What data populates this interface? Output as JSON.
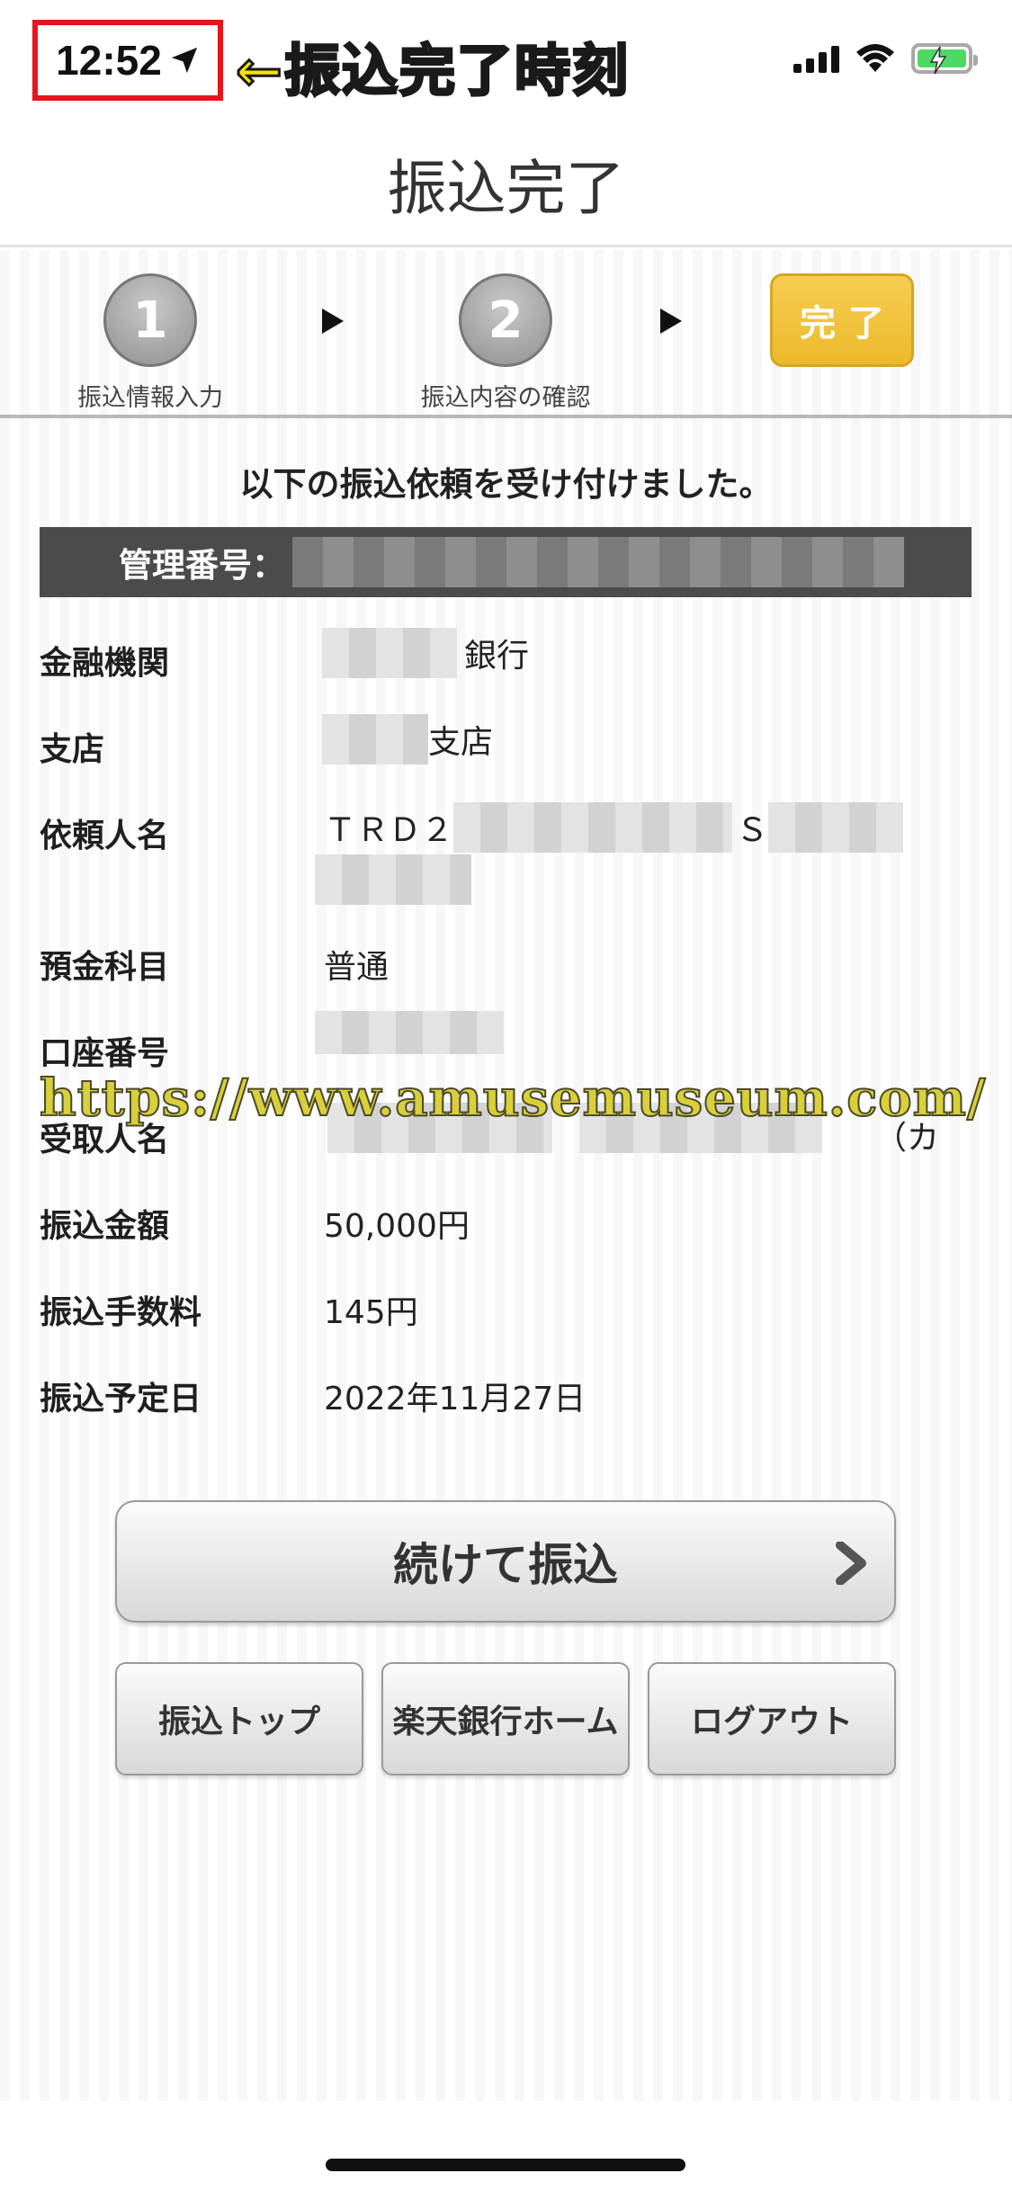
{
  "status_bar": {
    "time": "12:52",
    "annotation": "←振込完了時刻"
  },
  "header": {
    "title": "振込完了"
  },
  "steps": [
    {
      "number": "1",
      "label": "振込情報入力"
    },
    {
      "number": "2",
      "label": "振込内容の確認"
    },
    {
      "label": "完了"
    }
  ],
  "accept_message": "以下の振込依頼を受け付けました。",
  "management_number_label": "管理番号：",
  "details": {
    "bank": {
      "label": "金融機関",
      "suffix": "銀行"
    },
    "branch": {
      "label": "支店",
      "suffix": "支店"
    },
    "requester": {
      "label": "依頼人名",
      "prefix": "ＴＲＤ２",
      "mid": "Ｓ"
    },
    "deposit_type": {
      "label": "預金科目",
      "value": "普通"
    },
    "account_number": {
      "label": "口座番号"
    },
    "recipient": {
      "label": "受取人名",
      "suffix": "（カ"
    },
    "amount": {
      "label": "振込金額",
      "value": "50,000円"
    },
    "fee": {
      "label": "振込手数料",
      "value": "145円"
    },
    "scheduled_date": {
      "label": "振込予定日",
      "value": "2022年11月27日"
    }
  },
  "watermark": "https://www.amusemuseum.com/",
  "buttons": {
    "continue": "続けて振込",
    "transfer_top": "振込トップ",
    "bank_home": "楽天銀行ホーム",
    "logout": "ログアウト"
  },
  "colors": {
    "accent": "#f0c23a",
    "annotation_box": "#e8141b",
    "annotation_text": "#f6e300",
    "battery": "#4cd964"
  }
}
